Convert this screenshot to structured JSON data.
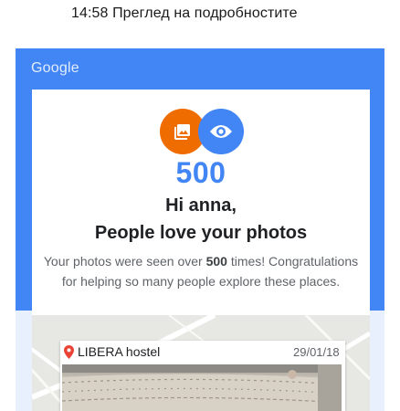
{
  "status_bar": {
    "text": "14:58 Преглед на подробностите"
  },
  "email": {
    "brand": "Google",
    "views_count": "500",
    "greeting": "Hi anna,",
    "headline": "People love your photos",
    "body_prefix": "Your photos were seen over ",
    "body_count": "500",
    "body_suffix": " times! Congratulations for helping so many people explore these places."
  },
  "place": {
    "name": "LIBERA hostel",
    "date": "29/01/18",
    "icons": [
      "location-pin-icon",
      "photos-icon",
      "eye-icon"
    ]
  },
  "colors": {
    "brand_blue": "#4285f4",
    "photos_orange": "#ef6c00",
    "pin_red": "#ea4335"
  }
}
